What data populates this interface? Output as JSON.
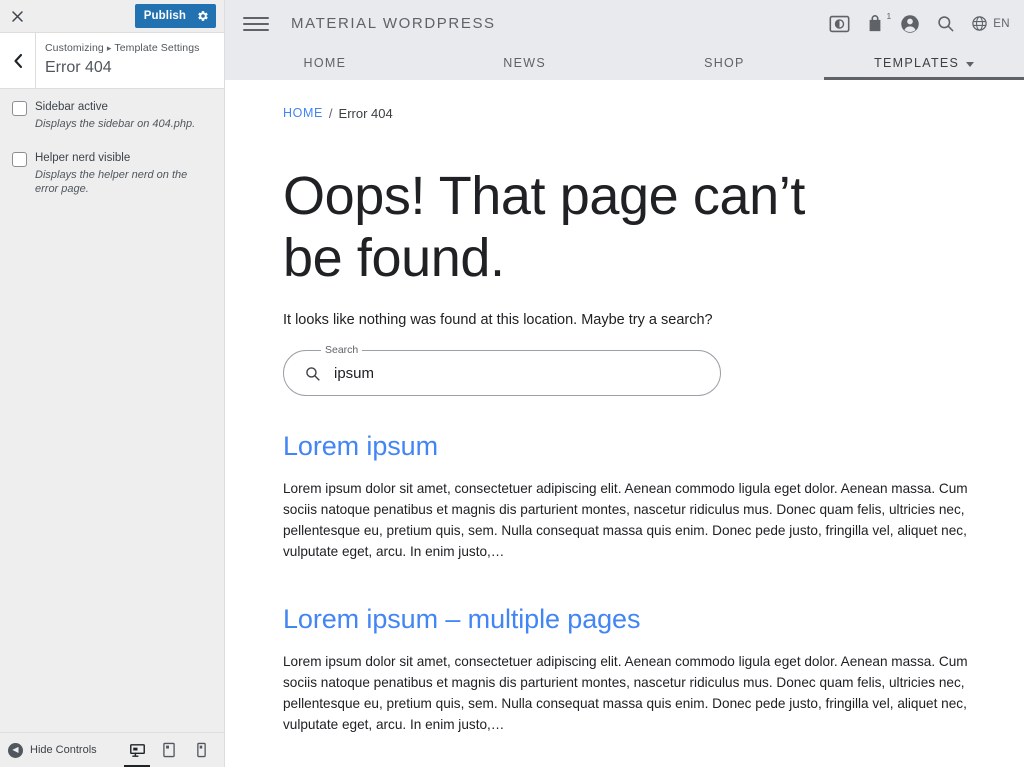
{
  "customizer": {
    "close_label": "Close",
    "publish_label": "Publish",
    "publish_settings_icon": "gear-icon",
    "back_icon": "chevron-left-icon",
    "breadcrumb": "Customizing",
    "breadcrumb_separator": "▸",
    "section": "Template Settings",
    "title": "Error 404",
    "controls": [
      {
        "label": "Sidebar active",
        "description": "Displays the sidebar on 404.php.",
        "checked": false
      },
      {
        "label": "Helper nerd visible",
        "description": "Displays the helper nerd on the error page.",
        "checked": false
      }
    ],
    "footer": {
      "hide_controls_label": "Hide Controls",
      "devices": [
        {
          "name": "desktop",
          "active": true
        },
        {
          "name": "tablet",
          "active": false
        },
        {
          "name": "mobile",
          "active": false
        }
      ]
    }
  },
  "site": {
    "menu_icon": "hamburger-menu-icon",
    "brand": "MATERIAL WORDPRESS",
    "actions": [
      {
        "name": "contrast-toggle-icon",
        "badge": ""
      },
      {
        "name": "shopping-bag-icon",
        "badge": "1"
      },
      {
        "name": "account-circle-icon",
        "badge": ""
      },
      {
        "name": "search-icon",
        "badge": ""
      }
    ],
    "language": {
      "icon": "globe-icon",
      "label": "EN"
    },
    "nav": [
      {
        "label": "HOME",
        "active": false,
        "has_dropdown": false
      },
      {
        "label": "NEWS",
        "active": false,
        "has_dropdown": false
      },
      {
        "label": "SHOP",
        "active": false,
        "has_dropdown": false
      },
      {
        "label": "TEMPLATES",
        "active": true,
        "has_dropdown": true
      }
    ],
    "breadcrumb": {
      "home": "HOME",
      "separator": "/",
      "current": "Error 404"
    },
    "error": {
      "title": "Oops! That page can’t be found.",
      "subtitle": "It looks like nothing was found at this location. Maybe try a search?"
    },
    "search": {
      "label": "Search",
      "value": "ipsum",
      "placeholder": "Search",
      "icon": "search-icon"
    },
    "results": [
      {
        "title": "Lorem ipsum",
        "excerpt": "Lorem ipsum dolor sit amet, consectetuer adipiscing elit. Aenean commodo ligula eget dolor. Aenean massa. Cum sociis natoque penatibus et magnis dis parturient montes, nascetur ridiculus mus. Donec quam felis, ultricies nec, pellentesque eu, pretium quis, sem. Nulla consequat massa quis enim. Donec pede justo, fringilla vel, aliquet nec, vulputate eget, arcu. In enim justo,…"
      },
      {
        "title": "Lorem ipsum – multiple pages",
        "excerpt": "Lorem ipsum dolor sit amet, consectetuer adipiscing elit. Aenean commodo ligula eget dolor. Aenean massa. Cum sociis natoque penatibus et magnis dis parturient montes, nascetur ridiculus mus. Donec quam felis, ultricies nec, pellentesque eu, pretium quis, sem. Nulla consequat massa quis enim. Donec pede justo, fringilla vel, aliquet nec, vulputate eget, arcu. In enim justo,…"
      }
    ]
  },
  "colors": {
    "publish_blue": "#2271b1",
    "link_blue": "#4285f4",
    "header_gray": "#e8eaed",
    "panel_gray": "#eeeeee",
    "text_dark": "#202124"
  }
}
